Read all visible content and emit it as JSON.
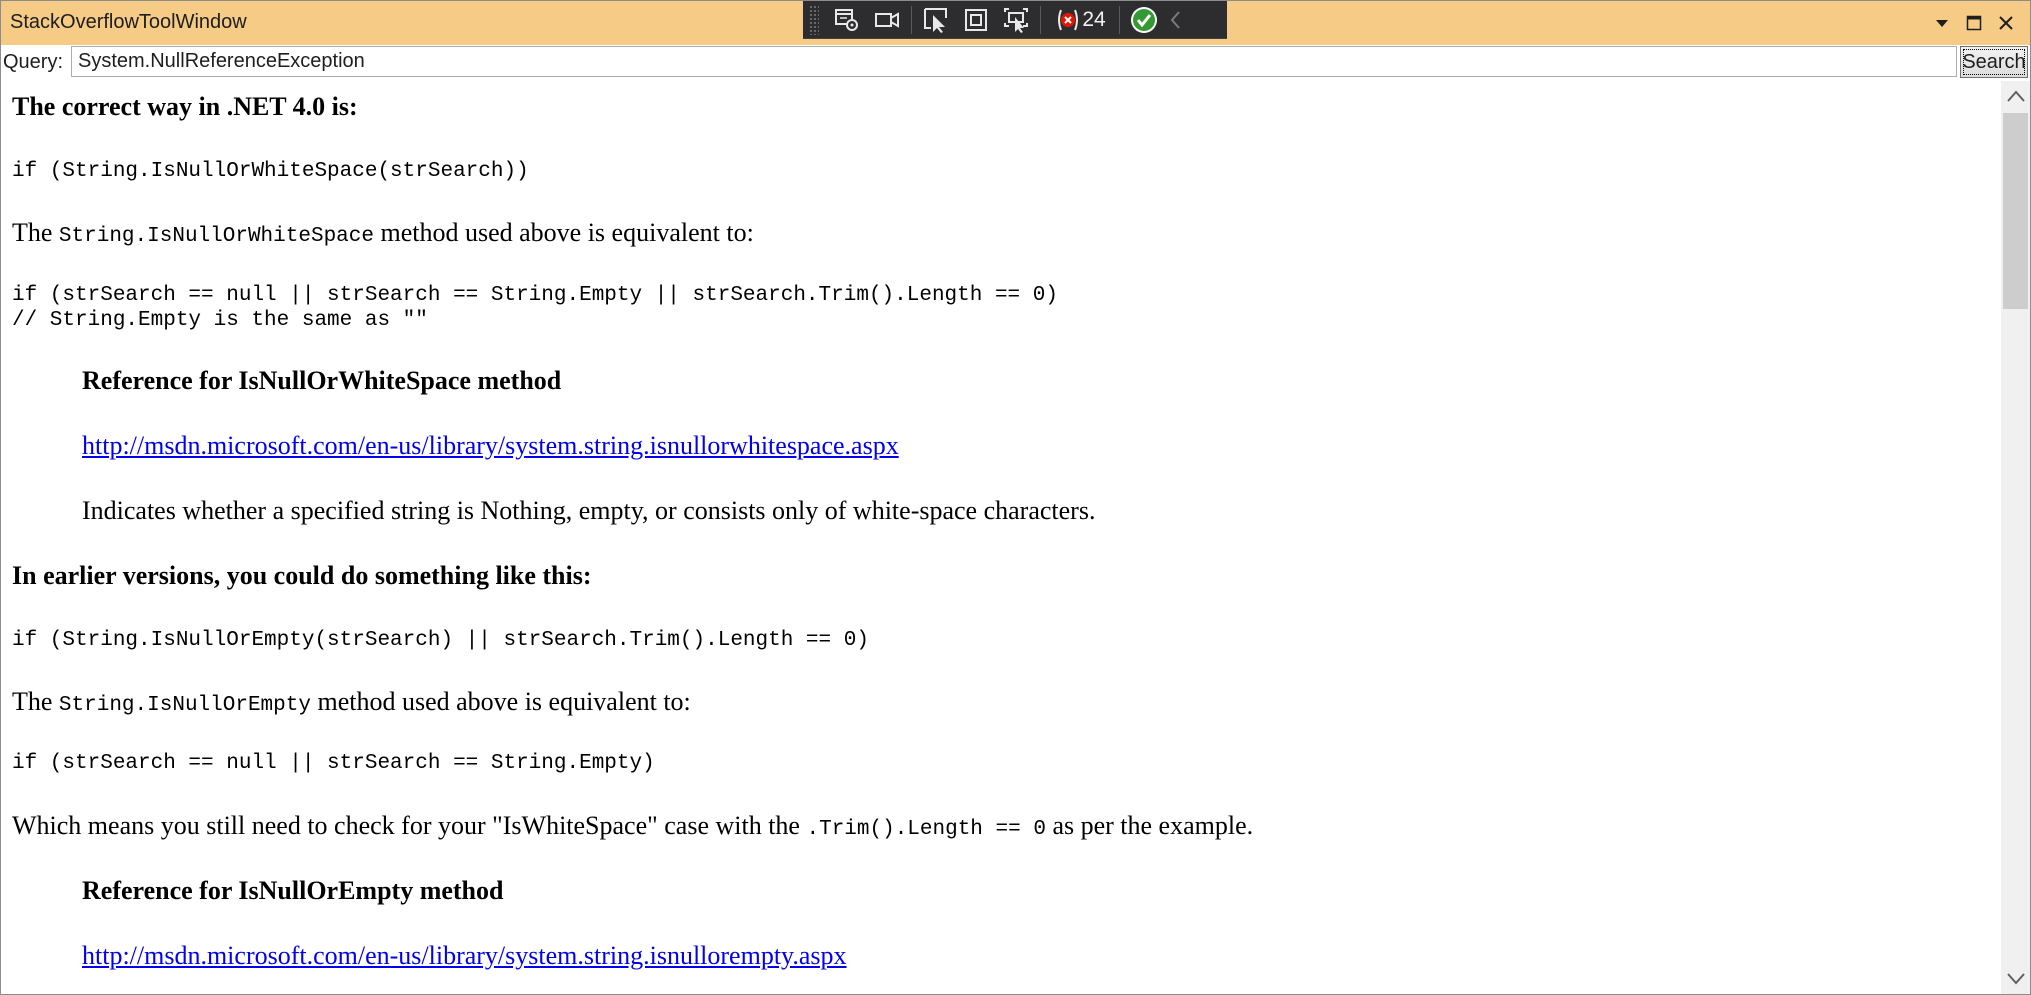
{
  "window": {
    "title": "StackOverflowToolWindow"
  },
  "debug_toolbar": {
    "exception_count": "24",
    "icons": [
      "live-visual-tree-icon",
      "video-camera-icon",
      "select-element-icon",
      "display-layout-adorners-icon",
      "track-focus-icon",
      "in-app-toolbar-exceptions-icon",
      "status-ok-icon",
      "collapse-chevron-icon"
    ]
  },
  "query": {
    "label": "Query:",
    "value": "System.NullReferenceException",
    "search_label": "Search"
  },
  "content": {
    "heading_1": "The correct way in .NET 4.0 is:",
    "code_1": "if (String.IsNullOrWhiteSpace(strSearch))",
    "para_1_pre": "The ",
    "para_1_code": "String.IsNullOrWhiteSpace",
    "para_1_post": " method used above is equivalent to:",
    "code_2_line_1": "if (strSearch == null || strSearch == String.Empty || strSearch.Trim().Length == 0)",
    "code_2_line_2": "// String.Empty is the same as \"\"",
    "ref_1_heading": "Reference for IsNullOrWhiteSpace method",
    "ref_1_link": "http://msdn.microsoft.com/en-us/library/system.string.isnullorwhitespace.aspx",
    "ref_1_desc": "Indicates whether a specified string is Nothing, empty, or consists only of white-space characters.",
    "heading_2": "In earlier versions, you could do something like this:",
    "code_3": "if (String.IsNullOrEmpty(strSearch) || strSearch.Trim().Length == 0)",
    "para_2_pre": "The ",
    "para_2_code": "String.IsNullOrEmpty",
    "para_2_post": " method used above is equivalent to:",
    "code_4": "if (strSearch == null || strSearch == String.Empty)",
    "para_3_pre": "Which means you still need to check for your \"IsWhiteSpace\" case with the ",
    "para_3_code": ".Trim().Length == 0",
    "para_3_post": " as per the example.",
    "ref_2_heading": "Reference for IsNullOrEmpty method",
    "ref_2_link": "http://msdn.microsoft.com/en-us/library/system.string.isnullorempty.aspx"
  },
  "colors": {
    "titlebar": "#f5cb85",
    "toolbar": "#2d2d30",
    "link": "#0000ee"
  }
}
